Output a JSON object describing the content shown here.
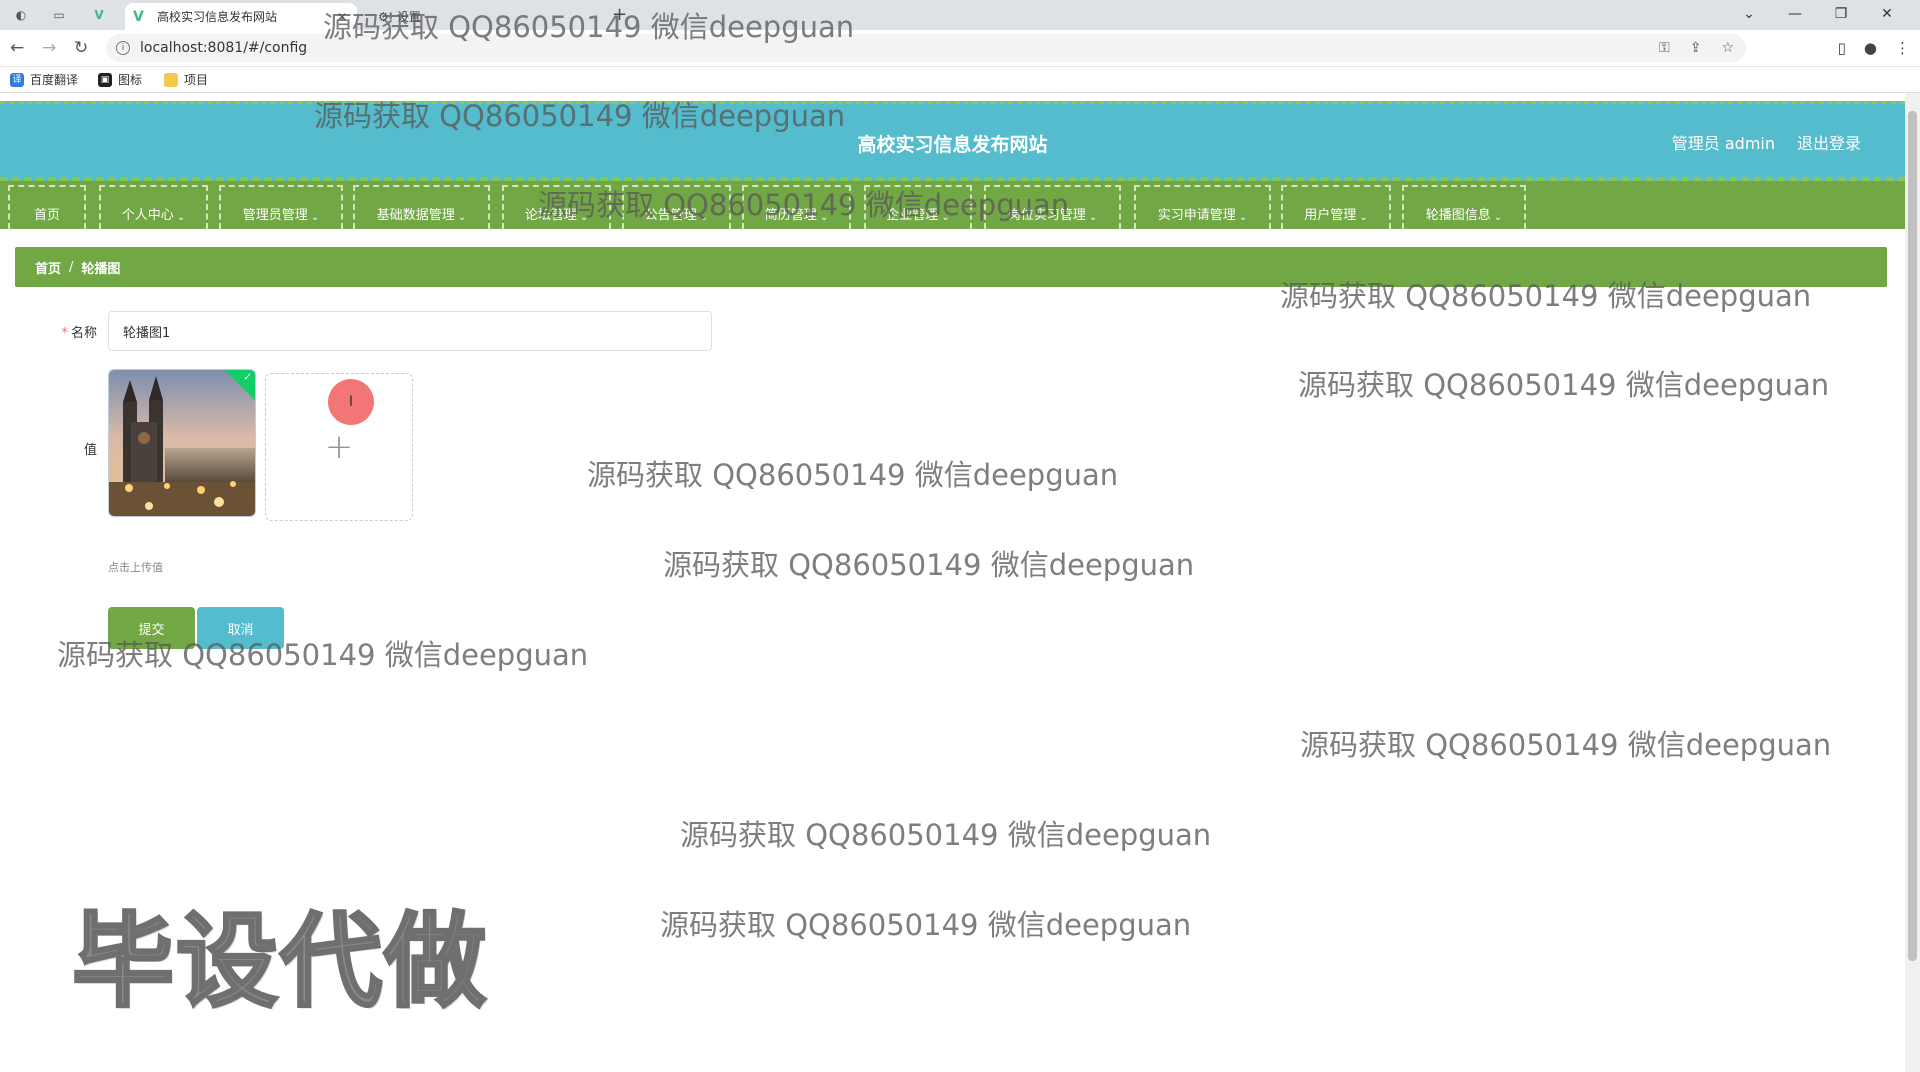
{
  "browser": {
    "active_tab_title": "高校实习信息发布网站",
    "second_tab_title": "设置",
    "url": "localhost:8081/#/config",
    "bookmarks": [
      "百度翻译",
      "图标",
      "项目"
    ]
  },
  "header": {
    "site_title": "高校实习信息发布网站",
    "admin_label": "管理员 admin",
    "logout_label": "退出登录"
  },
  "menu": [
    {
      "label": "首页",
      "has_dropdown": false
    },
    {
      "label": "个人中心",
      "has_dropdown": true
    },
    {
      "label": "管理员管理",
      "has_dropdown": true
    },
    {
      "label": "基础数据管理",
      "has_dropdown": true
    },
    {
      "label": "论坛管理",
      "has_dropdown": true
    },
    {
      "label": "公告管理",
      "has_dropdown": true
    },
    {
      "label": "简历管理",
      "has_dropdown": true
    },
    {
      "label": "企业管理",
      "has_dropdown": true
    },
    {
      "label": "岗位实习管理",
      "has_dropdown": true
    },
    {
      "label": "实习申请管理",
      "has_dropdown": true
    },
    {
      "label": "用户管理",
      "has_dropdown": true
    },
    {
      "label": "轮播图信息",
      "has_dropdown": true
    }
  ],
  "breadcrumb": {
    "home": "首页",
    "separator": "/",
    "current": "轮播图"
  },
  "form": {
    "name_label": "名称",
    "name_value": "轮播图1",
    "value_label": "值",
    "upload_tip": "点击上传值",
    "submit_label": "提交",
    "cancel_label": "取消"
  },
  "watermark": {
    "text": "源码获取 QQ86050149 微信deepguan",
    "big_text": "毕设代做"
  },
  "colors": {
    "header_bg": "#54bccc",
    "menu_bg": "#71a744",
    "accent_green": "#71a744",
    "accent_teal": "#54bccc"
  }
}
